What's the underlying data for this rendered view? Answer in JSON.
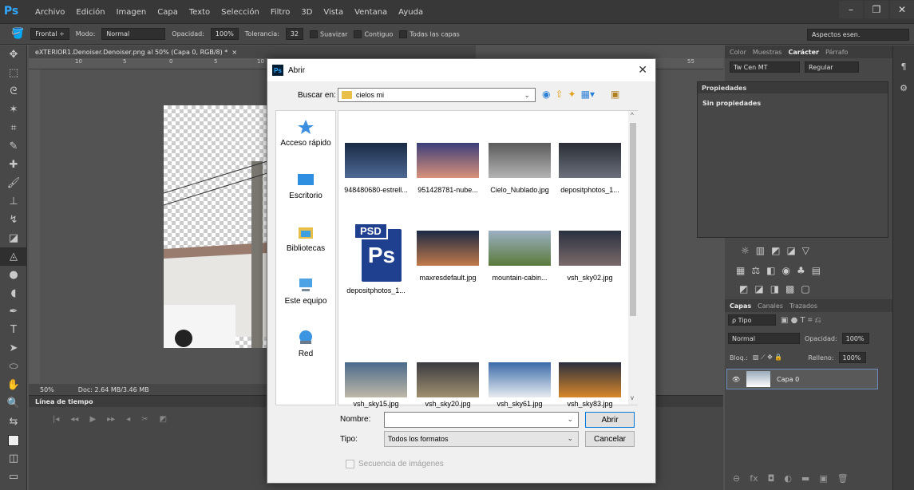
{
  "app": {
    "logo": "Ps"
  },
  "menu": [
    "Archivo",
    "Edición",
    "Imagen",
    "Capa",
    "Texto",
    "Selección",
    "Filtro",
    "3D",
    "Vista",
    "Ventana",
    "Ayuda"
  ],
  "window_controls": {
    "minimize": "–",
    "restore": "❐",
    "close": "✕"
  },
  "options": {
    "preset": "Frontal",
    "mode_label": "Modo:",
    "mode": "Normal",
    "opacity_label": "Opacidad:",
    "opacity": "100%",
    "tolerance_label": "Tolerancia:",
    "tolerance": "32",
    "smooth": "Suavizar",
    "contiguous": "Contiguo",
    "all_layers": "Todas las capas",
    "workspace": "Aspectos esen."
  },
  "document": {
    "tab_title": "eXTERIOR1.Denoiser.Denoiser.png al 50% (Capa 0, RGB/8) *",
    "tab_close": "×",
    "zoom": "50%",
    "doc_info": "Doc: 2.64 MB/3.46 MB",
    "ruler_h": [
      "10",
      "5",
      "0",
      "5",
      "10"
    ],
    "ruler_h_right": "55"
  },
  "timeline": {
    "title": "Línea de tiempo"
  },
  "right": {
    "top_tabs": [
      "Color",
      "Muestras",
      "Carácter",
      "Párrafo"
    ],
    "font": "Tw Cen MT",
    "font_style": "Regular",
    "props_title": "Propiedades",
    "props_body": "Sin propiedades",
    "layers_tabs": [
      "Capas",
      "Canales",
      "Trazados"
    ],
    "filter": "ρ Tipo",
    "blend": "Normal",
    "opacity_label": "Opacidad:",
    "opacity": "100%",
    "lock_label": "Bloq.:",
    "fill_label": "Relleno:",
    "fill": "100%",
    "layer_name": "Capa 0"
  },
  "dialog": {
    "title": "Abrir",
    "close": "✕",
    "lookin_label": "Buscar en:",
    "lookin_value": "cielos mi",
    "places": [
      "Acceso rápido",
      "Escritorio",
      "Bibliotecas",
      "Este equipo",
      "Red"
    ],
    "files": [
      {
        "name": "948480680-estrell...",
        "colors": [
          "#1a2a44",
          "#4e6a95"
        ]
      },
      {
        "name": "951428781-nube...",
        "colors": [
          "#3b3e7a",
          "#d9927a"
        ]
      },
      {
        "name": "Cielo_Nublado.jpg",
        "colors": [
          "#5b5b5b",
          "#b4b4b4"
        ]
      },
      {
        "name": "depositphotos_1...",
        "colors": [
          "#2a2d35",
          "#6b717c"
        ]
      },
      {
        "name": "depositphotos_1...",
        "colors": [
          "#001e36",
          "#31a8ff"
        ]
      },
      {
        "name": "maxresdefault.jpg",
        "colors": [
          "#1b2a45",
          "#c27a4a"
        ]
      },
      {
        "name": "mountain-cabin...",
        "colors": [
          "#9bb0c3",
          "#5a7a3a"
        ]
      },
      {
        "name": "vsh_sky02.jpg",
        "colors": [
          "#2a3040",
          "#7a6a6a"
        ]
      },
      {
        "name": "vsh_sky15.jpg",
        "colors": [
          "#4a6a8a",
          "#c0b8a8"
        ]
      },
      {
        "name": "vsh_sky20.jpg",
        "colors": [
          "#3a3a40",
          "#a09070"
        ]
      },
      {
        "name": "vsh_sky61.jpg",
        "colors": [
          "#3a6aa8",
          "#e8ecf0"
        ]
      },
      {
        "name": "vsh_sky83.jpg",
        "colors": [
          "#2a2e3e",
          "#d8882a"
        ]
      }
    ],
    "psd_label": "PSD",
    "ps_label": "Ps",
    "name_label": "Nombre:",
    "name_value": "",
    "type_label": "Tipo:",
    "type_value": "Todos los formatos",
    "open_button": "Abrir",
    "cancel_button": "Cancelar",
    "sequence_label": "Secuencia de imágenes"
  }
}
